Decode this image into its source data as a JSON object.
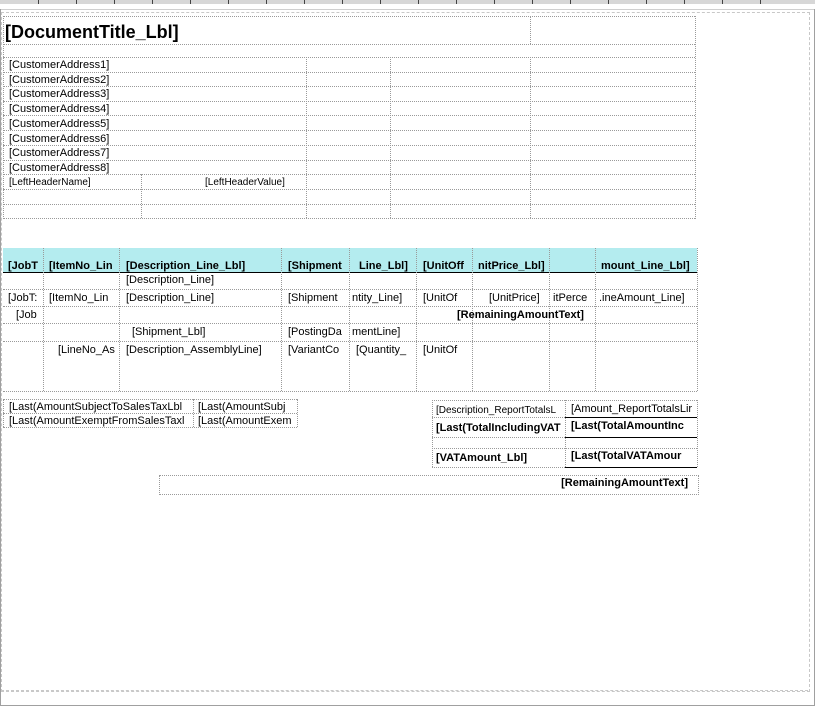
{
  "header": {
    "title": "[DocumentTitle_Lbl]",
    "addresses": [
      "[CustomerAddress1]",
      "[CustomerAddress2]",
      "[CustomerAddress3]",
      "[CustomerAddress4]",
      "[CustomerAddress5]",
      "[CustomerAddress6]",
      "[CustomerAddress7]",
      "[CustomerAddress8]"
    ],
    "left_header_name": "[LeftHeaderName]",
    "left_header_value": "[LeftHeaderValue]"
  },
  "lines_table": {
    "header_row": [
      "[JobT",
      "[ItemNo_Lin",
      "[Description_Line_Lbl]",
      "[Shipment",
      "Line_Lbl]",
      "[UnitOff",
      "nitPrice_Lbl]",
      "",
      "mount_Line_Lbl]"
    ],
    "row_description": "[Description_Line]",
    "data_row": [
      "[JobT:",
      "[ItemNo_Lin",
      "[Description_Line]",
      "[Shipment",
      "ntity_Line]",
      "[UnitOf",
      "[UnitPrice]",
      "itPerce",
      ".ineAmount_Line]"
    ],
    "job_cell": "[Job",
    "remaining_amount": "[RemainingAmountText]",
    "shipment_row": [
      "[Shipment_Lbl]",
      "[PostingDa",
      "mentLine]"
    ],
    "assembly_row": [
      "[LineNo_As",
      "[Description_AssemblyLine]",
      "[VariantCo",
      "[Quantity_",
      "[UnitOf"
    ]
  },
  "sales_tax": {
    "rows": [
      [
        "[Last(AmountSubjectToSalesTaxLbl",
        "[Last(AmountSubj"
      ],
      [
        "[Last(AmountExemptFromSalesTaxl",
        "[Last(AmountExem"
      ]
    ]
  },
  "totals": {
    "desc_lbl": "[Description_ReportTotalsL",
    "amount_lbl": "[Amount_ReportTotalsLir",
    "total_incl_vat": "[Last(TotalIncludingVAT",
    "total_amount_incl": "[Last(TotalAmountInc",
    "vat_amount_lbl": "[VATAmount_Lbl]",
    "total_vat_amount": "[Last(TotalVATAmour"
  },
  "footer": {
    "remaining_amount": "[RemainingAmountText]"
  },
  "colors": {
    "header_band": "#b4ecef",
    "grid_line": "#9a9a9a",
    "ruler": "#d7d7d7"
  }
}
